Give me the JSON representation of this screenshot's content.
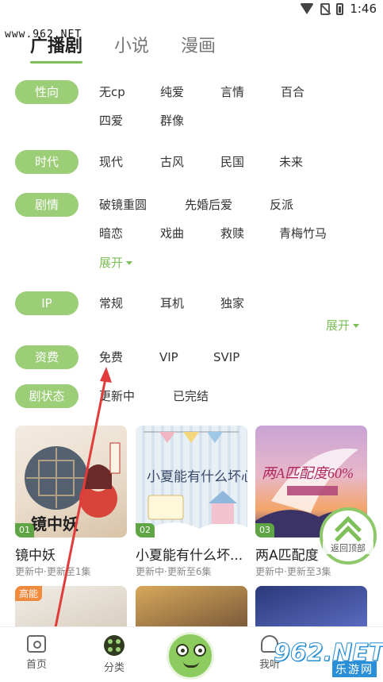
{
  "status": {
    "time": "1:46"
  },
  "watermark_top": "www.962.NET",
  "tabs": [
    {
      "label": "广播剧",
      "active": true
    },
    {
      "label": "小说",
      "active": false
    },
    {
      "label": "漫画",
      "active": false
    }
  ],
  "filters": {
    "orientation": {
      "label": "性向",
      "options": [
        "无cp",
        "纯爱",
        "言情",
        "百合",
        "四爱",
        "群像"
      ]
    },
    "era": {
      "label": "时代",
      "options": [
        "现代",
        "古风",
        "民国",
        "未来"
      ]
    },
    "plot": {
      "label": "剧情",
      "options": [
        "破镜重圆",
        "先婚后爱",
        "反派",
        "暗恋",
        "戏曲",
        "救赎",
        "青梅竹马"
      ],
      "expand": "展开"
    },
    "ip": {
      "label": "IP",
      "options": [
        "常规",
        "耳机",
        "独家"
      ],
      "expand": "展开"
    },
    "fee": {
      "label": "资费",
      "options": [
        "免费",
        "VIP",
        "SVIP"
      ]
    },
    "status": {
      "label": "剧状态",
      "options": [
        "更新中",
        "已完结"
      ]
    }
  },
  "cards": [
    {
      "num": "01",
      "title": "镜中妖",
      "sub": "更新中·更新至1集",
      "cover_text": "镜中妖"
    },
    {
      "num": "02",
      "title": "小夏能有什么坏...",
      "sub": "更新中·更新至6集",
      "cover_text": "小夏能有什么坏心思"
    },
    {
      "num": "03",
      "title": "两A匹配度",
      "sub": "更新中·更新至3集",
      "cover_text": "两A匹配度60%"
    }
  ],
  "row2": [
    {
      "tag": "高能"
    }
  ],
  "back_to_top": "返回顶部",
  "nav": [
    {
      "label": "首页",
      "icon": "home-icon"
    },
    {
      "label": "分类",
      "icon": "category-icon"
    },
    {
      "label": "",
      "icon": "frog-icon"
    },
    {
      "label": "我听",
      "icon": "me-icon"
    }
  ],
  "watermark_bottom": {
    "big": "962.NET",
    "small": "乐游网"
  },
  "colors": {
    "accent": "#7fbf5a",
    "pill": "#9ccd77",
    "arrow": "#e23b3b"
  }
}
